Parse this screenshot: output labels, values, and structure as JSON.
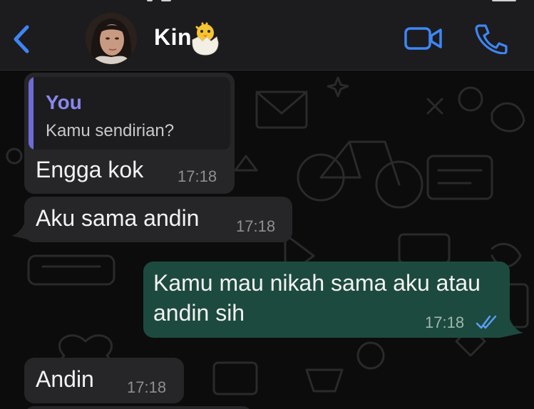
{
  "header": {
    "contact_name": "Kin",
    "back_icon": "chevron-left-icon",
    "video_icon": "video-camera-icon",
    "call_icon": "phone-icon",
    "accent_color": "#3e86f5"
  },
  "messages": [
    {
      "direction": "incoming",
      "quote_author": "You",
      "quote_text": "Kamu sendirian?",
      "text": "Engga kok",
      "time": "17:18"
    },
    {
      "direction": "incoming",
      "text": "Aku sama andin",
      "time": "17:18"
    },
    {
      "direction": "outgoing",
      "lines": [
        "Kamu mau nikah sama aku atau",
        "andin sih"
      ],
      "time": "17:18",
      "status_icon": "double-check-read-icon"
    },
    {
      "direction": "incoming",
      "text": "Andin",
      "time": "17:18"
    }
  ],
  "colors": {
    "incoming_bubble": "#262628",
    "outgoing_bubble": "#1d4a3e",
    "quote_accent": "#6e6ad7",
    "read_ticks": "#5aa0ff"
  }
}
